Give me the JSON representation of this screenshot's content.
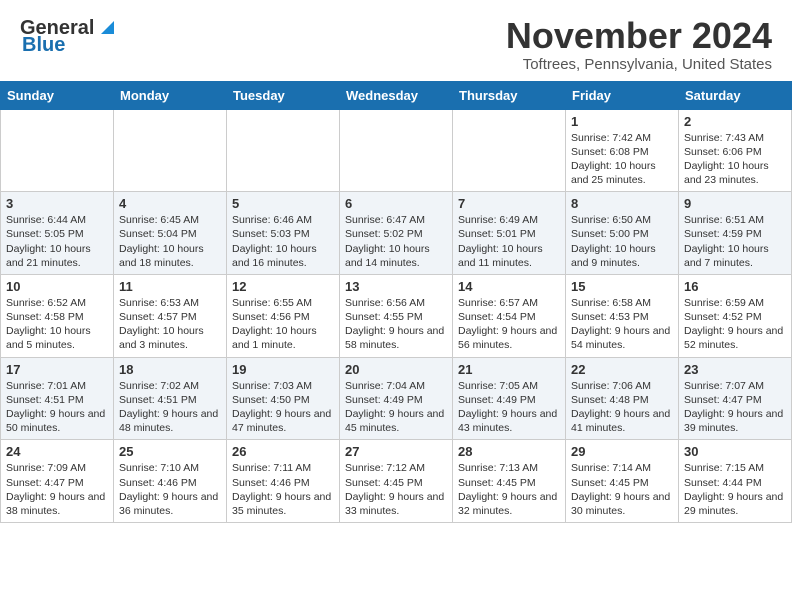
{
  "logo": {
    "line1": "General",
    "line2": "Blue"
  },
  "header": {
    "month": "November 2024",
    "location": "Toftrees, Pennsylvania, United States"
  },
  "weekdays": [
    "Sunday",
    "Monday",
    "Tuesday",
    "Wednesday",
    "Thursday",
    "Friday",
    "Saturday"
  ],
  "weeks": [
    [
      {
        "day": "",
        "info": ""
      },
      {
        "day": "",
        "info": ""
      },
      {
        "day": "",
        "info": ""
      },
      {
        "day": "",
        "info": ""
      },
      {
        "day": "",
        "info": ""
      },
      {
        "day": "1",
        "info": "Sunrise: 7:42 AM\nSunset: 6:08 PM\nDaylight: 10 hours and 25 minutes."
      },
      {
        "day": "2",
        "info": "Sunrise: 7:43 AM\nSunset: 6:06 PM\nDaylight: 10 hours and 23 minutes."
      }
    ],
    [
      {
        "day": "3",
        "info": "Sunrise: 6:44 AM\nSunset: 5:05 PM\nDaylight: 10 hours and 21 minutes."
      },
      {
        "day": "4",
        "info": "Sunrise: 6:45 AM\nSunset: 5:04 PM\nDaylight: 10 hours and 18 minutes."
      },
      {
        "day": "5",
        "info": "Sunrise: 6:46 AM\nSunset: 5:03 PM\nDaylight: 10 hours and 16 minutes."
      },
      {
        "day": "6",
        "info": "Sunrise: 6:47 AM\nSunset: 5:02 PM\nDaylight: 10 hours and 14 minutes."
      },
      {
        "day": "7",
        "info": "Sunrise: 6:49 AM\nSunset: 5:01 PM\nDaylight: 10 hours and 11 minutes."
      },
      {
        "day": "8",
        "info": "Sunrise: 6:50 AM\nSunset: 5:00 PM\nDaylight: 10 hours and 9 minutes."
      },
      {
        "day": "9",
        "info": "Sunrise: 6:51 AM\nSunset: 4:59 PM\nDaylight: 10 hours and 7 minutes."
      }
    ],
    [
      {
        "day": "10",
        "info": "Sunrise: 6:52 AM\nSunset: 4:58 PM\nDaylight: 10 hours and 5 minutes."
      },
      {
        "day": "11",
        "info": "Sunrise: 6:53 AM\nSunset: 4:57 PM\nDaylight: 10 hours and 3 minutes."
      },
      {
        "day": "12",
        "info": "Sunrise: 6:55 AM\nSunset: 4:56 PM\nDaylight: 10 hours and 1 minute."
      },
      {
        "day": "13",
        "info": "Sunrise: 6:56 AM\nSunset: 4:55 PM\nDaylight: 9 hours and 58 minutes."
      },
      {
        "day": "14",
        "info": "Sunrise: 6:57 AM\nSunset: 4:54 PM\nDaylight: 9 hours and 56 minutes."
      },
      {
        "day": "15",
        "info": "Sunrise: 6:58 AM\nSunset: 4:53 PM\nDaylight: 9 hours and 54 minutes."
      },
      {
        "day": "16",
        "info": "Sunrise: 6:59 AM\nSunset: 4:52 PM\nDaylight: 9 hours and 52 minutes."
      }
    ],
    [
      {
        "day": "17",
        "info": "Sunrise: 7:01 AM\nSunset: 4:51 PM\nDaylight: 9 hours and 50 minutes."
      },
      {
        "day": "18",
        "info": "Sunrise: 7:02 AM\nSunset: 4:51 PM\nDaylight: 9 hours and 48 minutes."
      },
      {
        "day": "19",
        "info": "Sunrise: 7:03 AM\nSunset: 4:50 PM\nDaylight: 9 hours and 47 minutes."
      },
      {
        "day": "20",
        "info": "Sunrise: 7:04 AM\nSunset: 4:49 PM\nDaylight: 9 hours and 45 minutes."
      },
      {
        "day": "21",
        "info": "Sunrise: 7:05 AM\nSunset: 4:49 PM\nDaylight: 9 hours and 43 minutes."
      },
      {
        "day": "22",
        "info": "Sunrise: 7:06 AM\nSunset: 4:48 PM\nDaylight: 9 hours and 41 minutes."
      },
      {
        "day": "23",
        "info": "Sunrise: 7:07 AM\nSunset: 4:47 PM\nDaylight: 9 hours and 39 minutes."
      }
    ],
    [
      {
        "day": "24",
        "info": "Sunrise: 7:09 AM\nSunset: 4:47 PM\nDaylight: 9 hours and 38 minutes."
      },
      {
        "day": "25",
        "info": "Sunrise: 7:10 AM\nSunset: 4:46 PM\nDaylight: 9 hours and 36 minutes."
      },
      {
        "day": "26",
        "info": "Sunrise: 7:11 AM\nSunset: 4:46 PM\nDaylight: 9 hours and 35 minutes."
      },
      {
        "day": "27",
        "info": "Sunrise: 7:12 AM\nSunset: 4:45 PM\nDaylight: 9 hours and 33 minutes."
      },
      {
        "day": "28",
        "info": "Sunrise: 7:13 AM\nSunset: 4:45 PM\nDaylight: 9 hours and 32 minutes."
      },
      {
        "day": "29",
        "info": "Sunrise: 7:14 AM\nSunset: 4:45 PM\nDaylight: 9 hours and 30 minutes."
      },
      {
        "day": "30",
        "info": "Sunrise: 7:15 AM\nSunset: 4:44 PM\nDaylight: 9 hours and 29 minutes."
      }
    ]
  ]
}
